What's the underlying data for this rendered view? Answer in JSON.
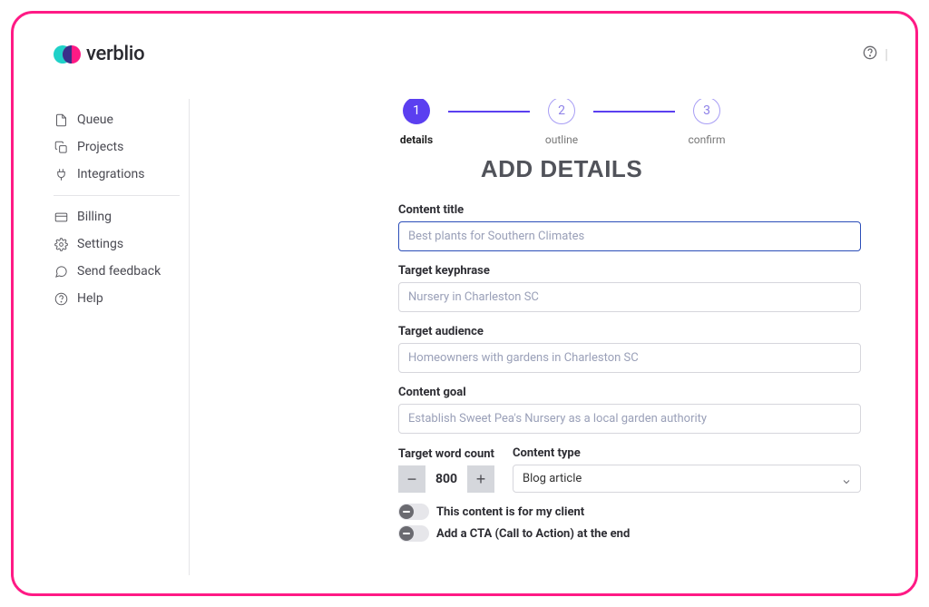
{
  "brand": {
    "name": "verblio"
  },
  "sidebar": {
    "items": [
      {
        "label": "Queue"
      },
      {
        "label": "Projects"
      },
      {
        "label": "Integrations"
      },
      {
        "label": "Billing"
      },
      {
        "label": "Settings"
      },
      {
        "label": "Send feedback"
      },
      {
        "label": "Help"
      }
    ]
  },
  "stepper": {
    "steps": [
      {
        "num": "1",
        "label": "details",
        "active": true
      },
      {
        "num": "2",
        "label": "outline",
        "active": false
      },
      {
        "num": "3",
        "label": "confirm",
        "active": false
      }
    ]
  },
  "page": {
    "title": "ADD DETAILS"
  },
  "form": {
    "content_title": {
      "label": "Content title",
      "placeholder": "Best plants for Southern Climates",
      "value": ""
    },
    "target_keyphrase": {
      "label": "Target keyphrase",
      "placeholder": "Nursery in Charleston SC",
      "value": ""
    },
    "target_audience": {
      "label": "Target audience",
      "placeholder": "Homeowners with gardens in Charleston SC",
      "value": ""
    },
    "content_goal": {
      "label": "Content goal",
      "placeholder": "Establish Sweet Pea's Nursery as a local garden authority",
      "value": ""
    },
    "word_count": {
      "label": "Target word count",
      "value": "800"
    },
    "content_type": {
      "label": "Content type",
      "selected": "Blog article"
    },
    "toggles": {
      "for_client": {
        "label": "This content is for my client",
        "on": false
      },
      "add_cta": {
        "label": "Add a CTA (Call to Action) at the end",
        "on": false
      }
    }
  }
}
